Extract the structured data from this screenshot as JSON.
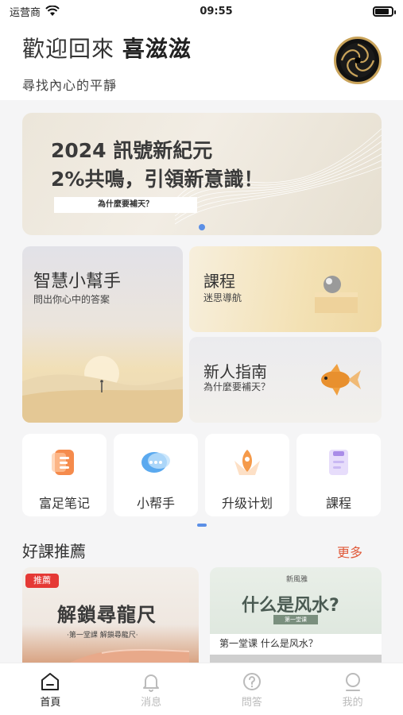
{
  "status_bar": {
    "carrier": "运营商",
    "time": "09:55",
    "battery_level": 0.85
  },
  "header": {
    "welcome": "歡迎回來",
    "username": "喜滋滋",
    "subtitle": "尋找內心的平靜"
  },
  "banner": {
    "line1": "2024 訊號新紀元",
    "line2": "2%共鳴，引領新意識！",
    "tag": "為什麼要補天？",
    "page_count": 1,
    "active_page": 1
  },
  "features": {
    "wisdom": {
      "title": "智慧小幫手",
      "subtitle": "問出你心中的答案"
    },
    "course": {
      "title": "課程",
      "subtitle": "迷思導航"
    },
    "guide": {
      "title": "新人指南",
      "subtitle": "為什麼要補天？"
    }
  },
  "quick_links": [
    {
      "label": "富足笔记",
      "icon": "notes-icon"
    },
    {
      "label": "小帮手",
      "icon": "chat-icon"
    },
    {
      "label": "升级计划",
      "icon": "upgrade-icon"
    },
    {
      "label": "課程",
      "icon": "course-icon"
    }
  ],
  "recommend": {
    "title": "好課推薦",
    "more": "更多",
    "items": [
      {
        "badge": "推薦",
        "title": "解鎖尋龍尺",
        "subtitle": "·第一堂課 解鎖尋龍尺·"
      },
      {
        "top": "新風雅",
        "title": "什么是风水?",
        "tag": "第一堂课",
        "caption": "第一堂课 什么是风水？"
      }
    ]
  },
  "tabs": [
    {
      "label": "首頁",
      "icon": "home-icon",
      "active": true
    },
    {
      "label": "消息",
      "icon": "bell-icon",
      "active": false
    },
    {
      "label": "問答",
      "icon": "question-icon",
      "active": false
    },
    {
      "label": "我的",
      "icon": "profile-icon",
      "active": false
    }
  ],
  "colors": {
    "accent": "#5b8fe6",
    "more": "#e05a3a",
    "badge": "#e53935"
  }
}
